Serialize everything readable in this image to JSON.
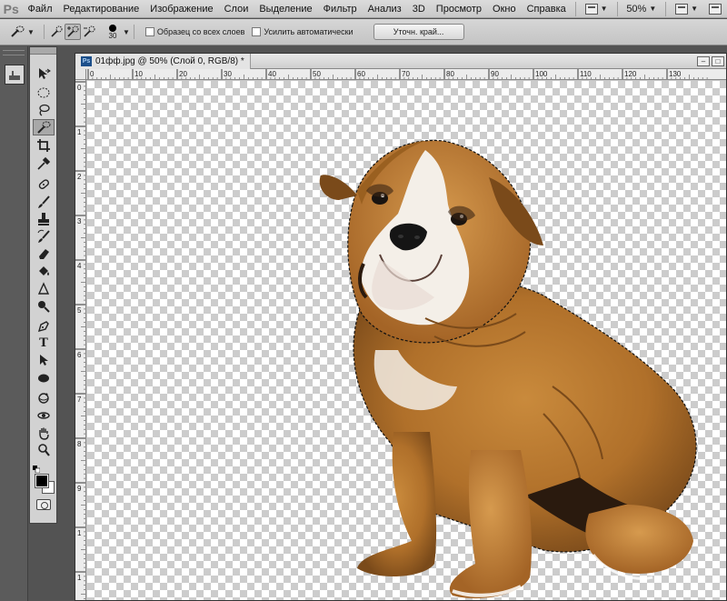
{
  "app": {
    "logo": "Ps"
  },
  "menubar": {
    "items": [
      "Файл",
      "Редактирование",
      "Изображение",
      "Слои",
      "Выделение",
      "Фильтр",
      "Анализ",
      "3D",
      "Просмотр",
      "Окно",
      "Справка"
    ],
    "zoom_label": "50%"
  },
  "options": {
    "brush_size": "30",
    "sample_all_layers": "Образец со всех слоев",
    "auto_enhance": "Усилить автоматически",
    "refine_edge": "Уточн. край..."
  },
  "document": {
    "tab_title": "01фф.jpg @ 50% (Слой 0, RGB/8) *",
    "ps_badge": "Ps",
    "ruler_h": [
      "0",
      "10",
      "20",
      "30",
      "40",
      "50",
      "60",
      "70",
      "80",
      "90",
      "100",
      "110",
      "120",
      "130"
    ],
    "ruler_v": [
      "0",
      "1",
      "2",
      "3",
      "4",
      "5",
      "6",
      "7",
      "8",
      "9",
      "1",
      "1",
      "1"
    ]
  },
  "tools": [
    {
      "name": "move-tool",
      "icon": "move-icon"
    },
    {
      "name": "marquee-tool",
      "icon": "ellipse-marquee-icon"
    },
    {
      "name": "lasso-tool",
      "icon": "lasso-icon"
    },
    {
      "name": "quick-selection-tool",
      "icon": "quick-selection-icon"
    },
    {
      "name": "crop-tool",
      "icon": "crop-icon"
    },
    {
      "name": "eyedropper-tool",
      "icon": "eyedropper-icon"
    },
    {
      "name": "healing-brush-tool",
      "icon": "healing-icon"
    },
    {
      "name": "brush-tool",
      "icon": "brush-icon"
    },
    {
      "name": "stamp-tool",
      "icon": "stamp-icon"
    },
    {
      "name": "history-brush-tool",
      "icon": "history-brush-icon"
    },
    {
      "name": "eraser-tool",
      "icon": "eraser-icon"
    },
    {
      "name": "paint-bucket-tool",
      "icon": "bucket-icon"
    },
    {
      "name": "blur-tool",
      "icon": "blur-icon"
    },
    {
      "name": "dodge-tool",
      "icon": "dodge-icon"
    },
    {
      "name": "pen-tool",
      "icon": "pen-icon"
    },
    {
      "name": "type-tool",
      "icon": "type-icon"
    },
    {
      "name": "path-selection-tool",
      "icon": "path-select-icon"
    },
    {
      "name": "shape-tool",
      "icon": "ellipse-shape-icon"
    },
    {
      "name": "3d-rotate-tool",
      "icon": "3d-rotate-icon"
    },
    {
      "name": "3d-orbit-tool",
      "icon": "3d-orbit-icon"
    },
    {
      "name": "hand-tool",
      "icon": "hand-icon"
    },
    {
      "name": "zoom-tool",
      "icon": "zoom-icon"
    }
  ],
  "colors": {
    "foreground": "#000000",
    "background": "#ffffff",
    "active_tool": "quick-selection-tool"
  }
}
